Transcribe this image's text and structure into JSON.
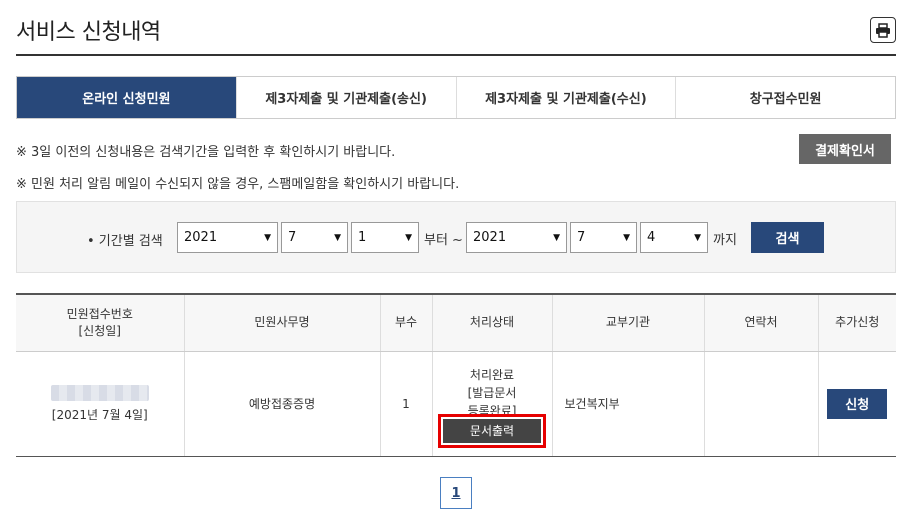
{
  "page": {
    "title": "서비스 신청내역"
  },
  "tabs": [
    {
      "label": "온라인 신청민원",
      "active": true
    },
    {
      "label": "제3자제출 및 기관제출(송신)",
      "active": false
    },
    {
      "label": "제3자제출 및 기관제출(수신)",
      "active": false
    },
    {
      "label": "창구접수민원",
      "active": false
    }
  ],
  "notices": [
    "※ 3일 이전의 신청내용은 검색기간을 입력한 후 확인하시기 바랍니다.",
    "※ 민원 처리 알림 메일이 수신되지 않을 경우, 스팸메일함을 확인하시기 바랍니다."
  ],
  "buttons": {
    "confirm": "결제확인서",
    "search": "검색"
  },
  "search": {
    "label": "• 기간별 검색",
    "from": {
      "year": "2021",
      "month": "7",
      "day": "1"
    },
    "to": {
      "year": "2021",
      "month": "7",
      "day": "4"
    },
    "from_suffix": "부터 ~",
    "to_suffix": "까지"
  },
  "table": {
    "headers": {
      "receipt_no_line1": "민원접수번호",
      "receipt_no_line2": "[신청일]",
      "service_name": "민원사무명",
      "copies": "부수",
      "status": "처리상태",
      "agency": "교부기관",
      "contact": "연락처",
      "extra": "추가신청"
    },
    "rows": [
      {
        "date": "[2021년 7월 4일]",
        "service_name": "예방접종증명",
        "copies": "1",
        "status_line1": "처리완료",
        "status_line2": "[발급문서",
        "status_line3": "등록완료]",
        "print_button": "문서출력",
        "agency": "보건복지부",
        "contact": "",
        "apply_button": "신청"
      }
    ]
  },
  "pagination": {
    "current": "1"
  },
  "colors": {
    "primary": "#28487a",
    "highlight": "#e60000",
    "gray_button": "#666666"
  }
}
